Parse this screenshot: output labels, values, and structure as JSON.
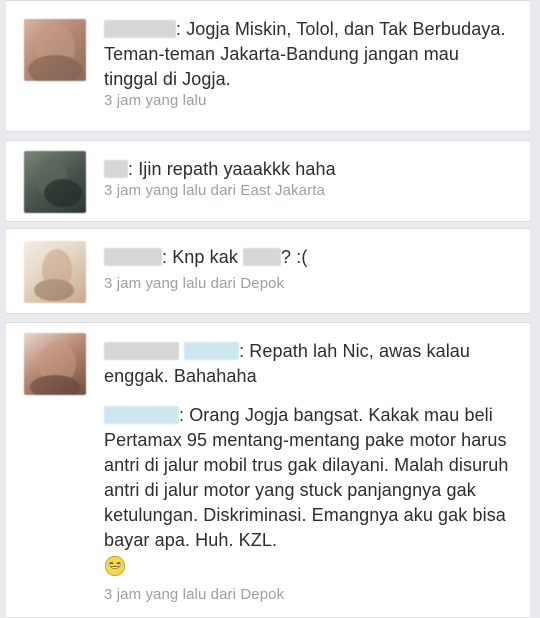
{
  "comments": [
    {
      "message": ": Jogja Miskin, Tolol, dan Tak Berbudaya. Teman-teman Jakarta-Bandung jangan mau tinggal di Jogja.",
      "time": "3 jam yang lalu"
    },
    {
      "message": ": Ijin repath yaaakkk haha",
      "time": "3 jam yang lalu dari East Jakarta"
    },
    {
      "message_prefix": ": Knp kak ",
      "message_suffix": "? :(",
      "time": "3 jam yang lalu dari Depok"
    },
    {
      "message_1": ": Repath lah Nic, awas kalau enggak. Bahahaha",
      "message_2": ": Orang Jogja bangsat. Kakak mau beli Pertamax 95 mentang-mentang pake motor harus antri di jalur mobil trus gak dilayani. Malah disuruh antri di jalur motor yang stuck panjangnya gak ketulungan. Diskriminasi. Emangnya aku gak bisa bayar apa. Huh. KZL.",
      "time": "3 jam yang lalu dari Depok"
    }
  ],
  "colors": {
    "background": "#e9eaed",
    "card": "#ffffff",
    "text": "#2d2d2d",
    "meta": "#9aa0a8"
  },
  "icons": {
    "avatar": "blurred-profile-photo",
    "emoji": "laughing-face-emoji"
  }
}
